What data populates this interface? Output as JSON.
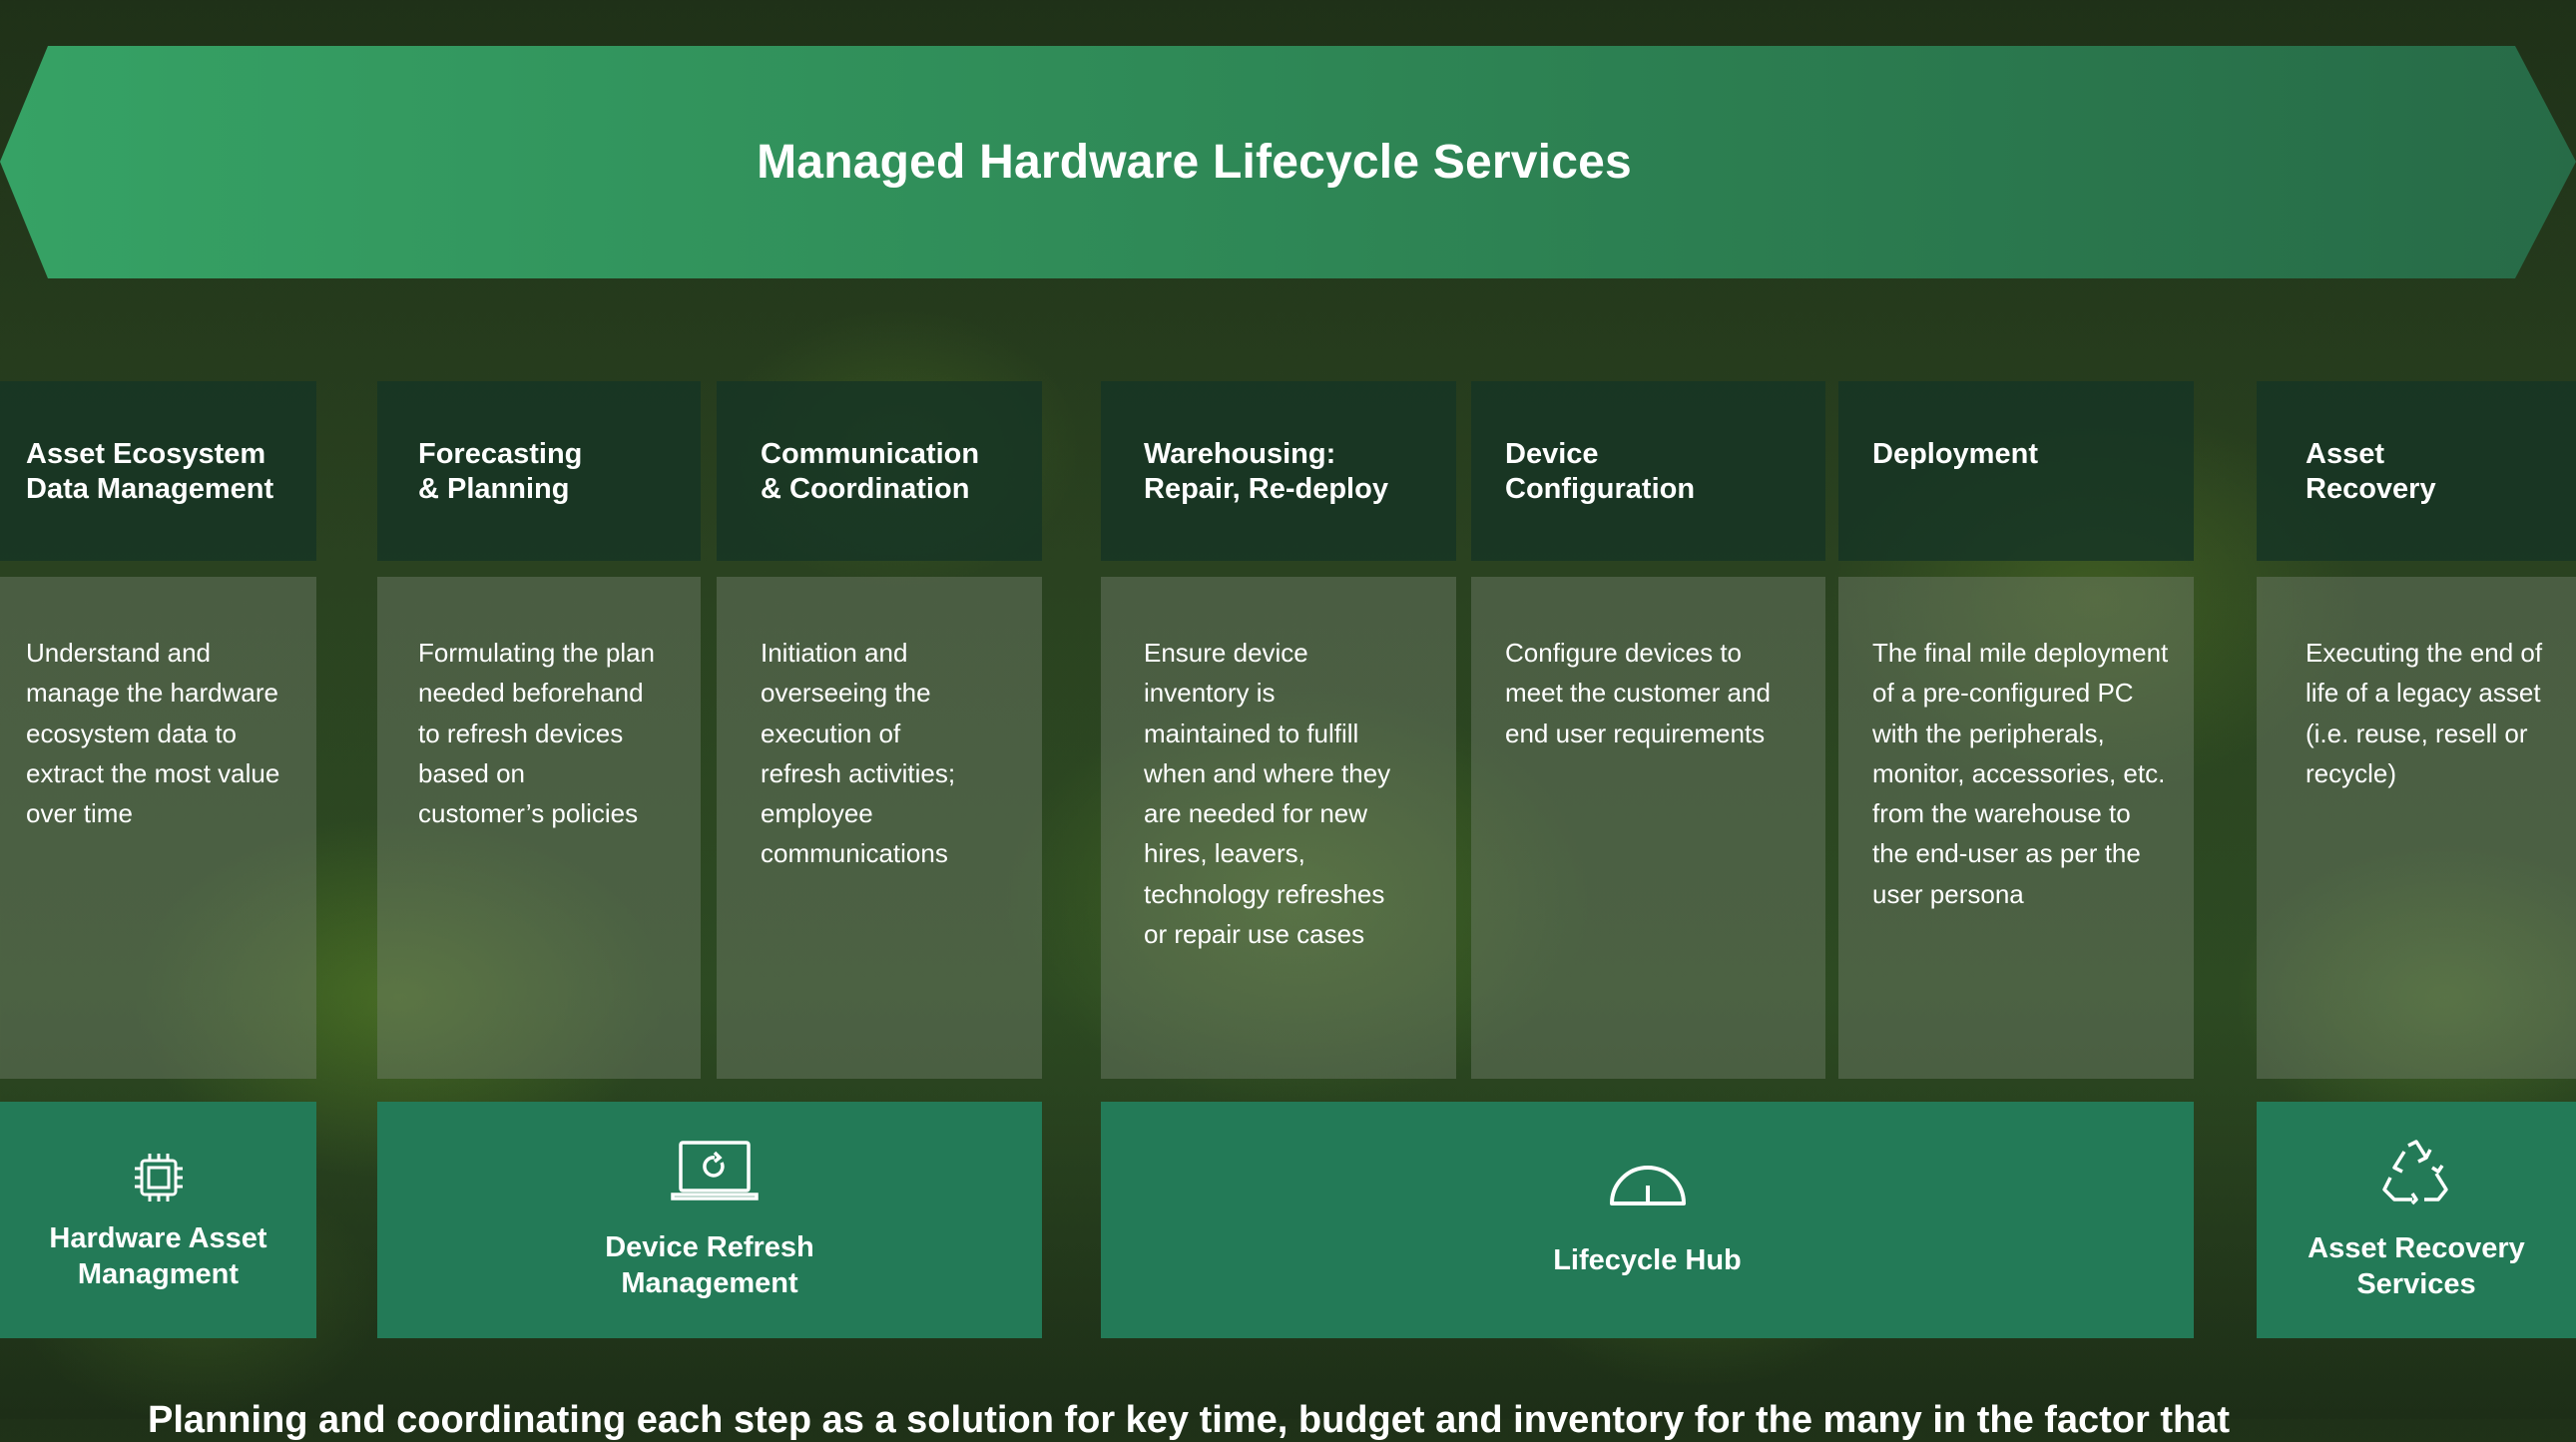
{
  "banner": {
    "title": "Managed Hardware Lifecycle Services"
  },
  "services": [
    {
      "title": "Asset Ecosystem\nData Management",
      "description": "Understand and manage the hardware ecosystem data to extract the most value over time"
    },
    {
      "title": "Forecasting\n& Planning",
      "description": "Formulating the plan needed beforehand to refresh devices based on customer’s policies"
    },
    {
      "title": "Communication\n& Coordination",
      "description": "Initiation and overseeing the execution of refresh activities; employee communications"
    },
    {
      "title": "Warehousing:\nRepair, Re-deploy",
      "description": "Ensure device inventory is maintained to fulfill when and where they are needed for new hires, leavers, technology refreshes or repair use cases"
    },
    {
      "title": "Device\nConfiguration",
      "description": "Configure devices to meet the customer and end user requirements"
    },
    {
      "title": "Deployment",
      "description": "The final mile deployment of a pre-configured PC with the peripherals, monitor, accessories, etc. from the warehouse to the end-user as per the user persona"
    },
    {
      "title": "Asset\nRecovery",
      "description": "Executing the end of life of a legacy asset (i.e. reuse, resell or recycle)"
    }
  ],
  "categories": [
    {
      "label": "Hardware Asset Managment",
      "icon": "chip-icon"
    },
    {
      "label": "Device Refresh Management",
      "icon": "laptop-refresh-icon"
    },
    {
      "label": "Lifecycle Hub",
      "icon": "gauge-icon"
    },
    {
      "label": "Asset Recovery Services",
      "icon": "recycle-icon"
    }
  ],
  "footer_text": "Planning and coordinating each step as a solution for key time, budget and inventory for the many in the factor that"
}
